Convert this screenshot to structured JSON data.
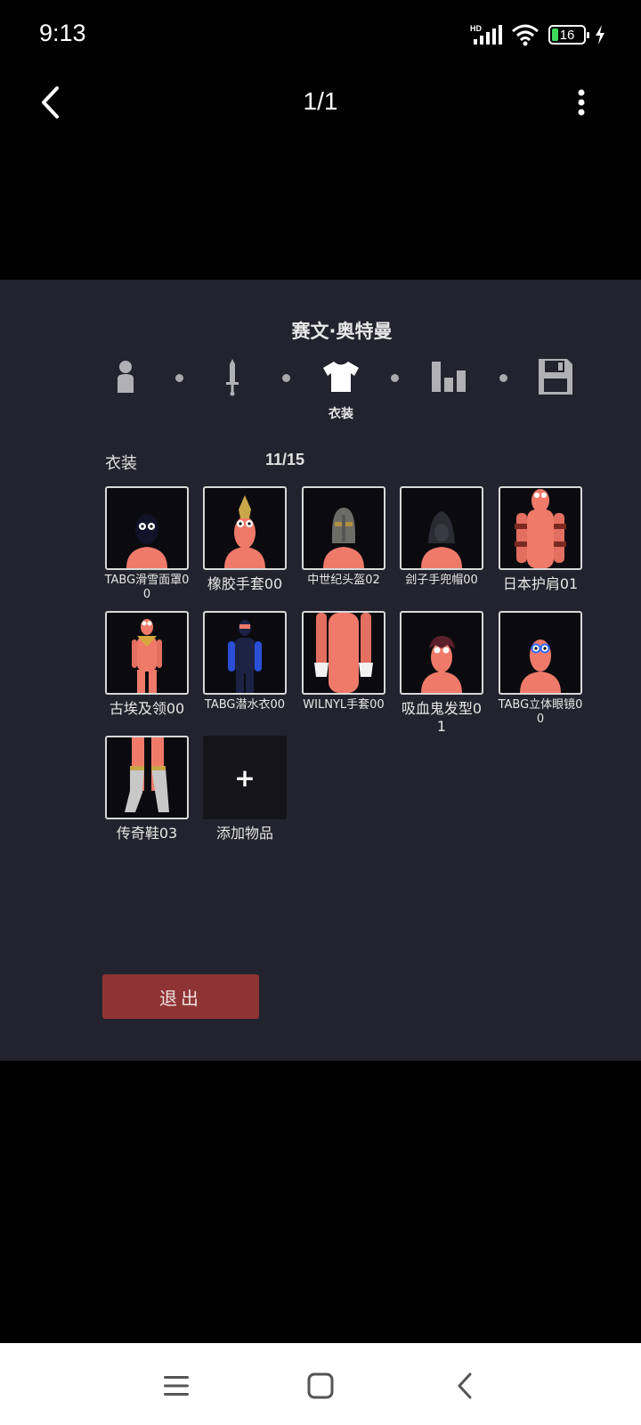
{
  "status_bar": {
    "time": "9:13",
    "network_label": "HD",
    "battery_level": "16"
  },
  "top_bar": {
    "page_counter": "1/1"
  },
  "game": {
    "player_name": "赛文·奥特曼",
    "steps": [
      {
        "icon": "person-icon"
      },
      {
        "icon": "sword-icon"
      },
      {
        "icon": "shirt-icon",
        "label": "衣装",
        "active": true
      },
      {
        "icon": "stats-icon"
      },
      {
        "icon": "save-icon"
      }
    ],
    "section_title": "衣装",
    "item_count": "11/15",
    "items": [
      {
        "label": "TABG滑雪面罩00"
      },
      {
        "label": "橡胶手套00"
      },
      {
        "label": "中世纪头盔02"
      },
      {
        "label": "刽子手兜帽00"
      },
      {
        "label": "日本护肩01"
      },
      {
        "label": "古埃及领00"
      },
      {
        "label": "TABG潜水衣00"
      },
      {
        "label": "WILNYL手套00"
      },
      {
        "label": "吸血鬼发型01"
      },
      {
        "label": "TABG立体眼镜00"
      },
      {
        "label": "传奇鞋03"
      }
    ],
    "add_item_symbol": "+",
    "add_item_label": "添加物品",
    "exit_label": "退出"
  },
  "colors": {
    "panel_bg": "#23232f",
    "exit_button": "#8f3434",
    "character_skin": "#f07a6a"
  }
}
